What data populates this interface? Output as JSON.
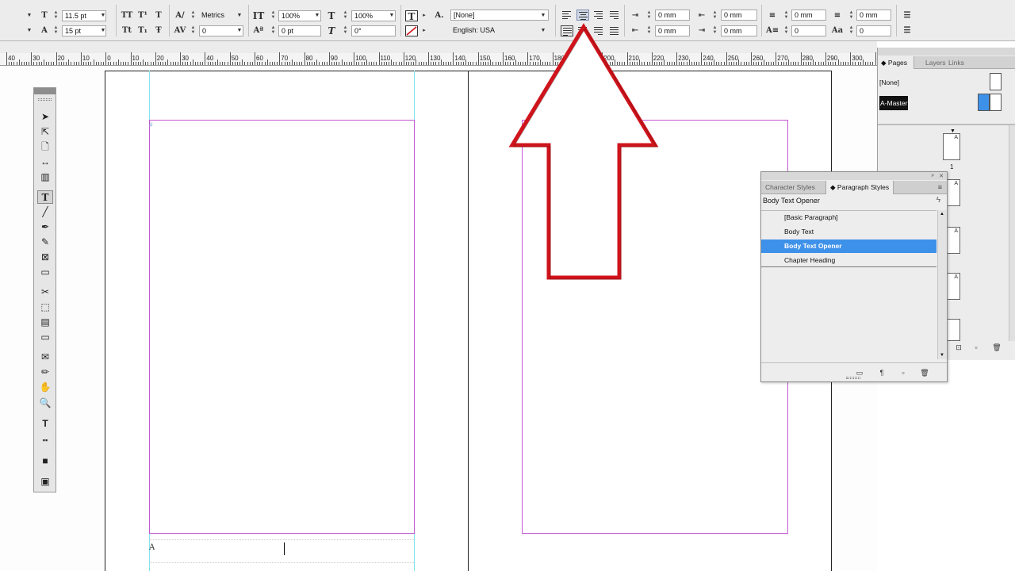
{
  "control_bar": {
    "leading_size": "11.5 pt",
    "baseline_size": "15 pt",
    "kerning": "Metrics",
    "tracking": "0",
    "vertical_scale": "100%",
    "horizontal_scale": "100%",
    "baseline_shift": "0 pt",
    "skew": "0°",
    "character_style": "[None]",
    "language": "English: USA",
    "left_indent": "0 mm",
    "first_line_indent": "0 mm",
    "right_indent": "0 mm",
    "last_line_indent": "0 mm",
    "space_before": "0 mm",
    "space_after": "0 mm",
    "drop_cap_lines": "0",
    "drop_cap_chars": "0",
    "active_alignment": "align-center"
  },
  "ruler": {
    "labels": [
      "40",
      "30",
      "20",
      "10",
      "0",
      "10",
      "20",
      "30",
      "40",
      "50",
      "60",
      "70",
      "80",
      "90",
      "100",
      "110",
      "120",
      "130",
      "140",
      "150",
      "160",
      "170",
      "180",
      "190",
      "200",
      "210",
      "220",
      "230",
      "240",
      "250",
      "260",
      "270",
      "280",
      "290",
      "300",
      "310"
    ]
  },
  "document": {
    "frame_marker": "A",
    "corner_marker": "#"
  },
  "tools": {
    "icons": [
      "selection-tool-icon",
      "direct-selection-tool-icon",
      "page-tool-icon",
      "gap-tool-icon",
      "content-collector-icon",
      "type-tool-icon",
      "line-tool-icon",
      "pen-tool-icon",
      "pencil-tool-icon",
      "rectangle-frame-tool-icon",
      "rectangle-tool-icon",
      "scissors-tool-icon",
      "free-transform-tool-icon",
      "gradient-swatch-tool-icon",
      "gradient-feather-tool-icon",
      "note-tool-icon",
      "eyedropper-tool-icon",
      "hand-tool-icon",
      "zoom-tool-icon",
      "fill-stroke-icon",
      "formatting-icon",
      "normal-view-icon",
      "screen-mode-icon"
    ],
    "active": "type-tool-icon"
  },
  "pages_panel": {
    "tabs": [
      "Pages",
      "Layers",
      "Links"
    ],
    "active_tab": "Pages",
    "masters": [
      "[None]",
      "A-Master"
    ],
    "selected_master": "A-Master",
    "page_marker": "A",
    "page_number": "1"
  },
  "styles_panel": {
    "tabs": [
      "Character Styles",
      "Paragraph Styles"
    ],
    "active_tab": "Paragraph Styles",
    "current_style": "Body Text Opener",
    "styles": [
      "[Basic Paragraph]",
      "Body Text",
      "Body Text Opener",
      "Chapter Heading"
    ],
    "selected_style": "Body Text Opener"
  },
  "colors": {
    "accent": "#3e91e9",
    "annotation_arrow": "#d0141c",
    "margin_guide": "#c257d2",
    "column_guide": "#7ee3ea"
  }
}
